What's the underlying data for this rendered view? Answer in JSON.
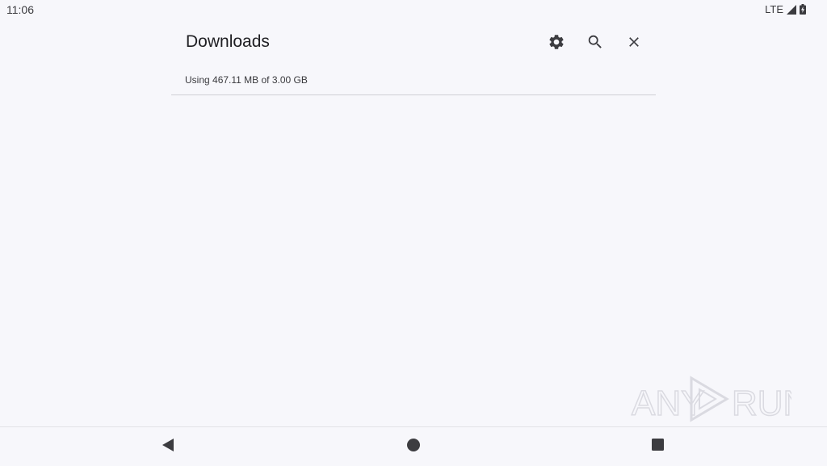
{
  "status_bar": {
    "time": "11:06",
    "network": "LTE",
    "signal_icon": "signal-icon",
    "battery_icon": "battery-charging-icon"
  },
  "header": {
    "title": "Downloads",
    "actions": [
      {
        "icon": "settings-gear-icon"
      },
      {
        "icon": "search-icon"
      },
      {
        "icon": "close-icon"
      }
    ]
  },
  "storage": {
    "text": "Using 467.11 MB of 3.00 GB"
  },
  "watermark": {
    "text_left": "ANY",
    "text_right": "RUN"
  },
  "nav_bar": {
    "back_icon": "back-triangle-icon",
    "home_icon": "home-circle-icon",
    "recents_icon": "recents-square-icon"
  },
  "colors": {
    "background": "#f7f7fb",
    "icon": "#3c3c40",
    "divider": "#cfcfd4"
  }
}
